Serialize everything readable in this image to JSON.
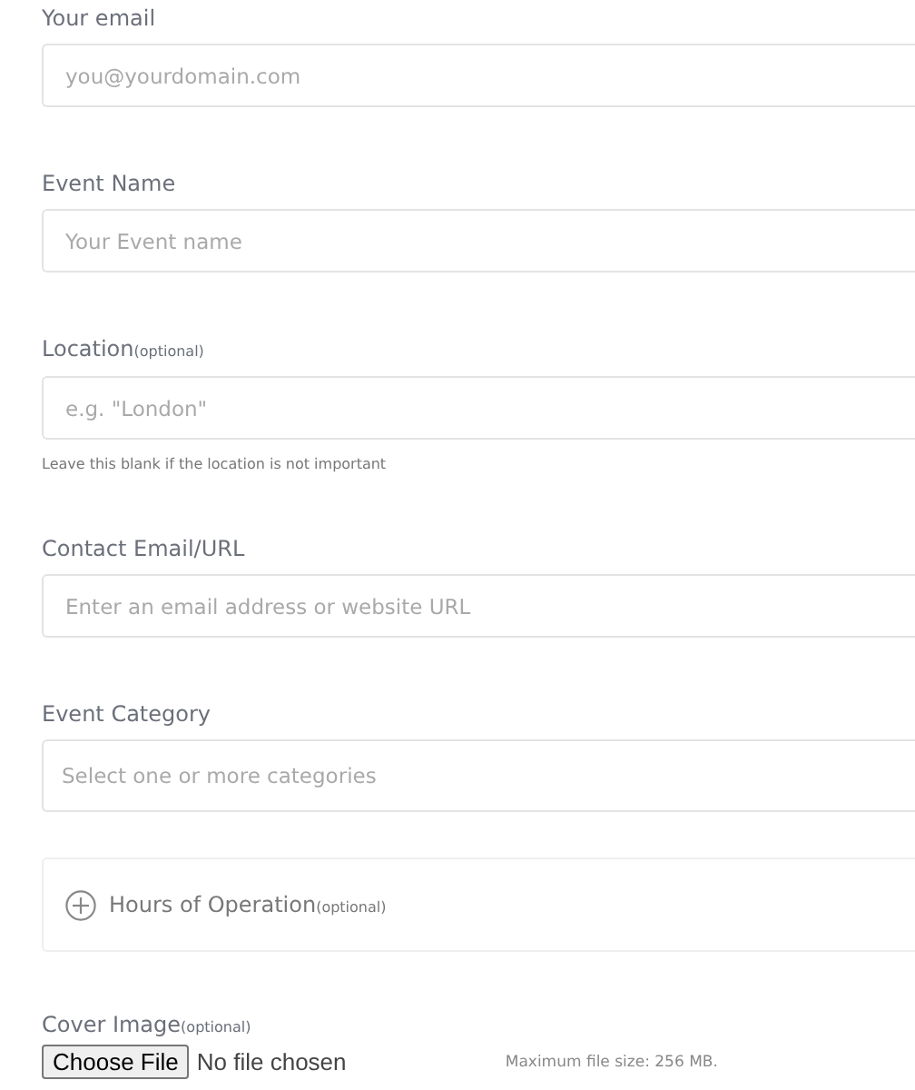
{
  "fields": [
    {
      "kind": "text",
      "label": "Your email",
      "placeholder": "you@yourdomain.com"
    },
    {
      "kind": "text",
      "label": "Event Name",
      "placeholder": "Your Event name"
    },
    {
      "kind": "text",
      "label": "Location",
      "optional": "(optional)",
      "placeholder": "e.g. \"London\"",
      "help": "Leave this blank if the location is not important"
    },
    {
      "kind": "text",
      "label": "Contact Email/URL",
      "placeholder": "Enter an email address or website URL"
    },
    {
      "kind": "select",
      "label": "Event Category",
      "placeholder": "Select one or more categories"
    },
    {
      "kind": "panel",
      "label": "Hours of Operation",
      "optional": "(optional)",
      "expanded": false
    },
    {
      "kind": "file",
      "label": "Cover Image",
      "optional": "(optional)",
      "button": "Choose File",
      "status": "No file chosen",
      "note": "Maximum file size: 256 MB."
    }
  ]
}
